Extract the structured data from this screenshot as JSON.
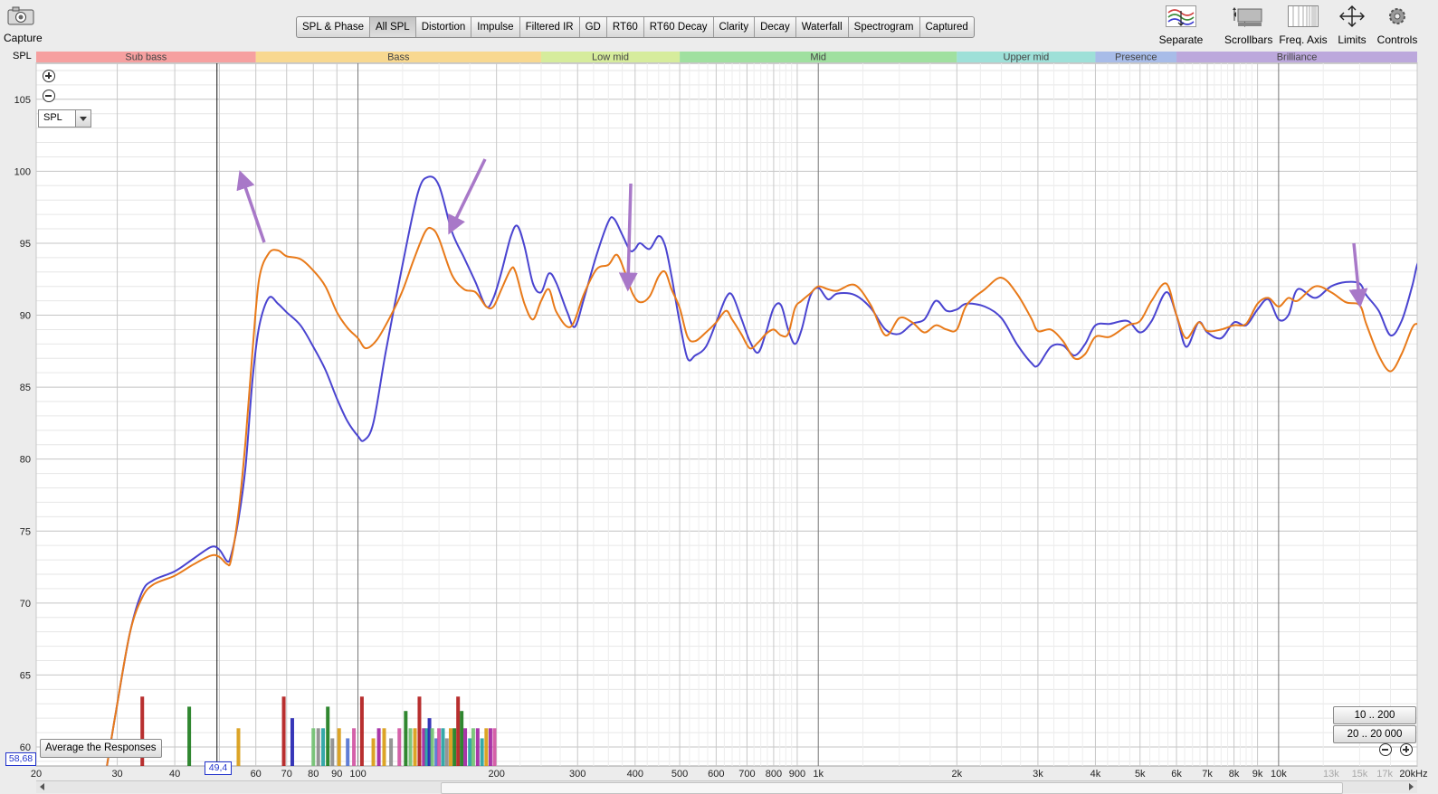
{
  "toolbar": {
    "capture": {
      "label": "Capture",
      "icon": "camera-icon"
    },
    "tabs": [
      "SPL & Phase",
      "All SPL",
      "Distortion",
      "Impulse",
      "Filtered IR",
      "GD",
      "RT60",
      "RT60 Decay",
      "Clarity",
      "Decay",
      "Waterfall",
      "Spectrogram",
      "Captured"
    ],
    "active_tab": "All SPL",
    "right_buttons": [
      {
        "label": "Separate",
        "icon": "separate-traces-icon"
      },
      {
        "label": "Scrollbars",
        "icon": "scrollbars-icon"
      },
      {
        "label": "Freq. Axis",
        "icon": "freq-axis-icon"
      },
      {
        "label": "Limits",
        "icon": "limits-icon"
      },
      {
        "label": "Controls",
        "icon": "gear-icon"
      }
    ]
  },
  "band_strip": {
    "bands": [
      {
        "name": "Sub bass",
        "from": 20,
        "to": 60,
        "color": "#f6a0a0"
      },
      {
        "name": "Bass",
        "from": 60,
        "to": 250,
        "color": "#f8d890"
      },
      {
        "name": "Low mid",
        "from": 250,
        "to": 500,
        "color": "#d6ec9c"
      },
      {
        "name": "Mid",
        "from": 500,
        "to": 2000,
        "color": "#a0e0a0"
      },
      {
        "name": "Upper mid",
        "from": 2000,
        "to": 4000,
        "color": "#9ee0d8"
      },
      {
        "name": "Presence",
        "from": 4000,
        "to": 6000,
        "color": "#a8bce8"
      },
      {
        "name": "Brilliance",
        "from": 6000,
        "to": 20000,
        "color": "#bca8dc"
      }
    ]
  },
  "spl_axis_title": "SPL",
  "spl_select": {
    "value": "SPL"
  },
  "cursor_readout": "58,68",
  "freq_cursor_readout": "49,4",
  "average_button": "Average the Responses",
  "range_buttons": [
    "10 .. 200",
    "20 .. 20 000"
  ],
  "colors": {
    "blue_trace": "#4a44d0",
    "orange_trace": "#e87a1a",
    "annotation_arrows": "#a878c8"
  },
  "chart_data": {
    "type": "line",
    "x_scale": "log",
    "xlim": [
      20,
      20000
    ],
    "ylim": [
      58.68,
      107.5
    ],
    "y_ticks": [
      60,
      65,
      70,
      75,
      80,
      85,
      90,
      95,
      100,
      105
    ],
    "x_ticks": [
      {
        "v": 20,
        "label": "20"
      },
      {
        "v": 30,
        "label": "30"
      },
      {
        "v": 40,
        "label": "40"
      },
      {
        "v": 60,
        "label": "60"
      },
      {
        "v": 70,
        "label": "70"
      },
      {
        "v": 80,
        "label": "80"
      },
      {
        "v": 90,
        "label": "90"
      },
      {
        "v": 100,
        "label": "100"
      },
      {
        "v": 200,
        "label": "200"
      },
      {
        "v": 300,
        "label": "300"
      },
      {
        "v": 400,
        "label": "400"
      },
      {
        "v": 500,
        "label": "500"
      },
      {
        "v": 600,
        "label": "600"
      },
      {
        "v": 700,
        "label": "700"
      },
      {
        "v": 800,
        "label": "800"
      },
      {
        "v": 900,
        "label": "900"
      },
      {
        "v": 1000,
        "label": "1k"
      },
      {
        "v": 2000,
        "label": "2k"
      },
      {
        "v": 3000,
        "label": "3k"
      },
      {
        "v": 4000,
        "label": "4k"
      },
      {
        "v": 5000,
        "label": "5k"
      },
      {
        "v": 6000,
        "label": "6k"
      },
      {
        "v": 7000,
        "label": "7k"
      },
      {
        "v": 8000,
        "label": "8k"
      },
      {
        "v": 9000,
        "label": "9k"
      },
      {
        "v": 10000,
        "label": "10k"
      },
      {
        "v": 13000,
        "label": "13k",
        "dim": true
      },
      {
        "v": 15000,
        "label": "15k",
        "dim": true
      },
      {
        "v": 17000,
        "label": "17k",
        "dim": true
      },
      {
        "v": 20000,
        "label": "20kHz"
      }
    ],
    "cursor_freq": 49.4,
    "grid": true,
    "series": [
      {
        "color": "#4a44d0",
        "points": [
          [
            28.5,
            58.7
          ],
          [
            30,
            63
          ],
          [
            32,
            68
          ],
          [
            34,
            70.8
          ],
          [
            36,
            71.6
          ],
          [
            40,
            72.2
          ],
          [
            44,
            73.1
          ],
          [
            48,
            73.9
          ],
          [
            50,
            73.7
          ],
          [
            52,
            72.9
          ],
          [
            53,
            73.3
          ],
          [
            55,
            75.8
          ],
          [
            57,
            79.5
          ],
          [
            59,
            85.5
          ],
          [
            61,
            89.2
          ],
          [
            64,
            91.2
          ],
          [
            67,
            90.8
          ],
          [
            70,
            90.2
          ],
          [
            75,
            89.3
          ],
          [
            80,
            87.8
          ],
          [
            85,
            86.2
          ],
          [
            90,
            84.2
          ],
          [
            95,
            82.6
          ],
          [
            100,
            81.6
          ],
          [
            103,
            81.3
          ],
          [
            108,
            82.5
          ],
          [
            115,
            87.5
          ],
          [
            125,
            93.5
          ],
          [
            135,
            98.5
          ],
          [
            142,
            99.6
          ],
          [
            150,
            99
          ],
          [
            160,
            95.8
          ],
          [
            170,
            94
          ],
          [
            180,
            92.3
          ],
          [
            190,
            90.6
          ],
          [
            197,
            91.2
          ],
          [
            205,
            93
          ],
          [
            215,
            95.5
          ],
          [
            222,
            96.2
          ],
          [
            230,
            94.8
          ],
          [
            240,
            92.2
          ],
          [
            250,
            91.6
          ],
          [
            260,
            92.9
          ],
          [
            270,
            92.2
          ],
          [
            285,
            90.2
          ],
          [
            296,
            89.2
          ],
          [
            310,
            91.2
          ],
          [
            330,
            94.2
          ],
          [
            350,
            96.5
          ],
          [
            360,
            96.7
          ],
          [
            375,
            95.6
          ],
          [
            390,
            94.5
          ],
          [
            400,
            94.6
          ],
          [
            410,
            95
          ],
          [
            430,
            94.6
          ],
          [
            450,
            95.5
          ],
          [
            465,
            94.8
          ],
          [
            480,
            92.7
          ],
          [
            500,
            89.5
          ],
          [
            520,
            87
          ],
          [
            540,
            87.2
          ],
          [
            570,
            87.8
          ],
          [
            600,
            89.5
          ],
          [
            630,
            91.2
          ],
          [
            650,
            91.4
          ],
          [
            680,
            89.8
          ],
          [
            710,
            88.2
          ],
          [
            740,
            87.4
          ],
          [
            770,
            88.8
          ],
          [
            800,
            90.5
          ],
          [
            830,
            90.7
          ],
          [
            860,
            89
          ],
          [
            890,
            88
          ],
          [
            920,
            89
          ],
          [
            960,
            91.3
          ],
          [
            1000,
            91.9
          ],
          [
            1050,
            91.1
          ],
          [
            1100,
            91.5
          ],
          [
            1200,
            91.4
          ],
          [
            1300,
            90.5
          ],
          [
            1400,
            89
          ],
          [
            1500,
            88.7
          ],
          [
            1600,
            89.4
          ],
          [
            1700,
            89.7
          ],
          [
            1800,
            91
          ],
          [
            1900,
            90.3
          ],
          [
            2000,
            90.4
          ],
          [
            2100,
            90.8
          ],
          [
            2300,
            90.6
          ],
          [
            2500,
            89.8
          ],
          [
            2700,
            88
          ],
          [
            2900,
            86.7
          ],
          [
            3000,
            86.5
          ],
          [
            3200,
            87.8
          ],
          [
            3400,
            87.9
          ],
          [
            3600,
            87.2
          ],
          [
            3800,
            88
          ],
          [
            4000,
            89.3
          ],
          [
            4300,
            89.4
          ],
          [
            4700,
            89.6
          ],
          [
            5000,
            88.8
          ],
          [
            5300,
            89.6
          ],
          [
            5700,
            91.6
          ],
          [
            6000,
            90
          ],
          [
            6300,
            87.8
          ],
          [
            6700,
            89.5
          ],
          [
            7000,
            88.8
          ],
          [
            7500,
            88.4
          ],
          [
            8000,
            89.5
          ],
          [
            8500,
            89.3
          ],
          [
            9000,
            90.4
          ],
          [
            9500,
            91.1
          ],
          [
            10000,
            89.7
          ],
          [
            10500,
            90
          ],
          [
            11000,
            91.8
          ],
          [
            12000,
            91.2
          ],
          [
            13000,
            92
          ],
          [
            14000,
            92.3
          ],
          [
            15000,
            92.2
          ],
          [
            15500,
            91.4
          ],
          [
            16500,
            90.3
          ],
          [
            17500,
            88.6
          ],
          [
            18500,
            89.6
          ],
          [
            19500,
            92
          ],
          [
            20000,
            93.5
          ],
          [
            20500,
            94
          ]
        ]
      },
      {
        "color": "#e87a1a",
        "points": [
          [
            28.5,
            58.7
          ],
          [
            30,
            63
          ],
          [
            32,
            68
          ],
          [
            34,
            70.4
          ],
          [
            36,
            71.3
          ],
          [
            40,
            71.9
          ],
          [
            44,
            72.7
          ],
          [
            48,
            73.3
          ],
          [
            50,
            73.2
          ],
          [
            52,
            72.7
          ],
          [
            53,
            73
          ],
          [
            55,
            76.3
          ],
          [
            57,
            81.3
          ],
          [
            59,
            87.5
          ],
          [
            61,
            92.5
          ],
          [
            64,
            94.3
          ],
          [
            67,
            94.5
          ],
          [
            70,
            94.1
          ],
          [
            75,
            93.9
          ],
          [
            80,
            93.1
          ],
          [
            85,
            92
          ],
          [
            90,
            90.2
          ],
          [
            95,
            89.1
          ],
          [
            100,
            88.4
          ],
          [
            104,
            87.7
          ],
          [
            110,
            88.3
          ],
          [
            118,
            90
          ],
          [
            125,
            91.7
          ],
          [
            132,
            93.8
          ],
          [
            140,
            95.8
          ],
          [
            145,
            96
          ],
          [
            150,
            95.3
          ],
          [
            160,
            92.8
          ],
          [
            170,
            91.8
          ],
          [
            180,
            91.6
          ],
          [
            190,
            90.6
          ],
          [
            197,
            90.6
          ],
          [
            205,
            91.8
          ],
          [
            215,
            93.2
          ],
          [
            220,
            93
          ],
          [
            230,
            90.8
          ],
          [
            240,
            89.7
          ],
          [
            250,
            91
          ],
          [
            260,
            91.8
          ],
          [
            270,
            90.2
          ],
          [
            290,
            89.2
          ],
          [
            310,
            91.5
          ],
          [
            330,
            93.2
          ],
          [
            350,
            93.5
          ],
          [
            365,
            94.2
          ],
          [
            380,
            93
          ],
          [
            395,
            91.5
          ],
          [
            410,
            90.9
          ],
          [
            430,
            91.3
          ],
          [
            450,
            92.7
          ],
          [
            465,
            93
          ],
          [
            480,
            91.8
          ],
          [
            500,
            90.5
          ],
          [
            520,
            88.5
          ],
          [
            540,
            88.2
          ],
          [
            570,
            88.8
          ],
          [
            600,
            89.5
          ],
          [
            630,
            90.3
          ],
          [
            650,
            89.7
          ],
          [
            680,
            88.7
          ],
          [
            710,
            87.7
          ],
          [
            740,
            88.1
          ],
          [
            770,
            88.7
          ],
          [
            800,
            89
          ],
          [
            830,
            88.6
          ],
          [
            860,
            88.7
          ],
          [
            890,
            90.5
          ],
          [
            920,
            91
          ],
          [
            960,
            91.5
          ],
          [
            1000,
            92
          ],
          [
            1050,
            91.8
          ],
          [
            1100,
            91.7
          ],
          [
            1200,
            92.1
          ],
          [
            1300,
            90.7
          ],
          [
            1400,
            88.6
          ],
          [
            1500,
            89.8
          ],
          [
            1600,
            89.5
          ],
          [
            1700,
            88.8
          ],
          [
            1800,
            89.3
          ],
          [
            1900,
            89
          ],
          [
            2000,
            89
          ],
          [
            2100,
            90.7
          ],
          [
            2300,
            91.8
          ],
          [
            2500,
            92.6
          ],
          [
            2700,
            91.5
          ],
          [
            2900,
            89.8
          ],
          [
            3000,
            88.9
          ],
          [
            3200,
            89
          ],
          [
            3400,
            88.2
          ],
          [
            3600,
            87
          ],
          [
            3800,
            87.3
          ],
          [
            4000,
            88.5
          ],
          [
            4300,
            88.5
          ],
          [
            4700,
            89.3
          ],
          [
            5000,
            89.6
          ],
          [
            5300,
            91
          ],
          [
            5700,
            92.2
          ],
          [
            6000,
            90
          ],
          [
            6300,
            88.4
          ],
          [
            6700,
            89.5
          ],
          [
            7000,
            88.9
          ],
          [
            7500,
            89
          ],
          [
            8000,
            89.3
          ],
          [
            8500,
            89.4
          ],
          [
            9000,
            90.8
          ],
          [
            9500,
            91.2
          ],
          [
            10000,
            90.6
          ],
          [
            10500,
            91.2
          ],
          [
            11000,
            91
          ],
          [
            12000,
            92
          ],
          [
            13000,
            91.6
          ],
          [
            14000,
            90.9
          ],
          [
            15000,
            90.7
          ],
          [
            15500,
            89.4
          ],
          [
            16500,
            87.2
          ],
          [
            17500,
            86.1
          ],
          [
            18500,
            87.3
          ],
          [
            19500,
            89.1
          ],
          [
            20000,
            89.4
          ],
          [
            20500,
            89.2
          ]
        ]
      }
    ]
  }
}
